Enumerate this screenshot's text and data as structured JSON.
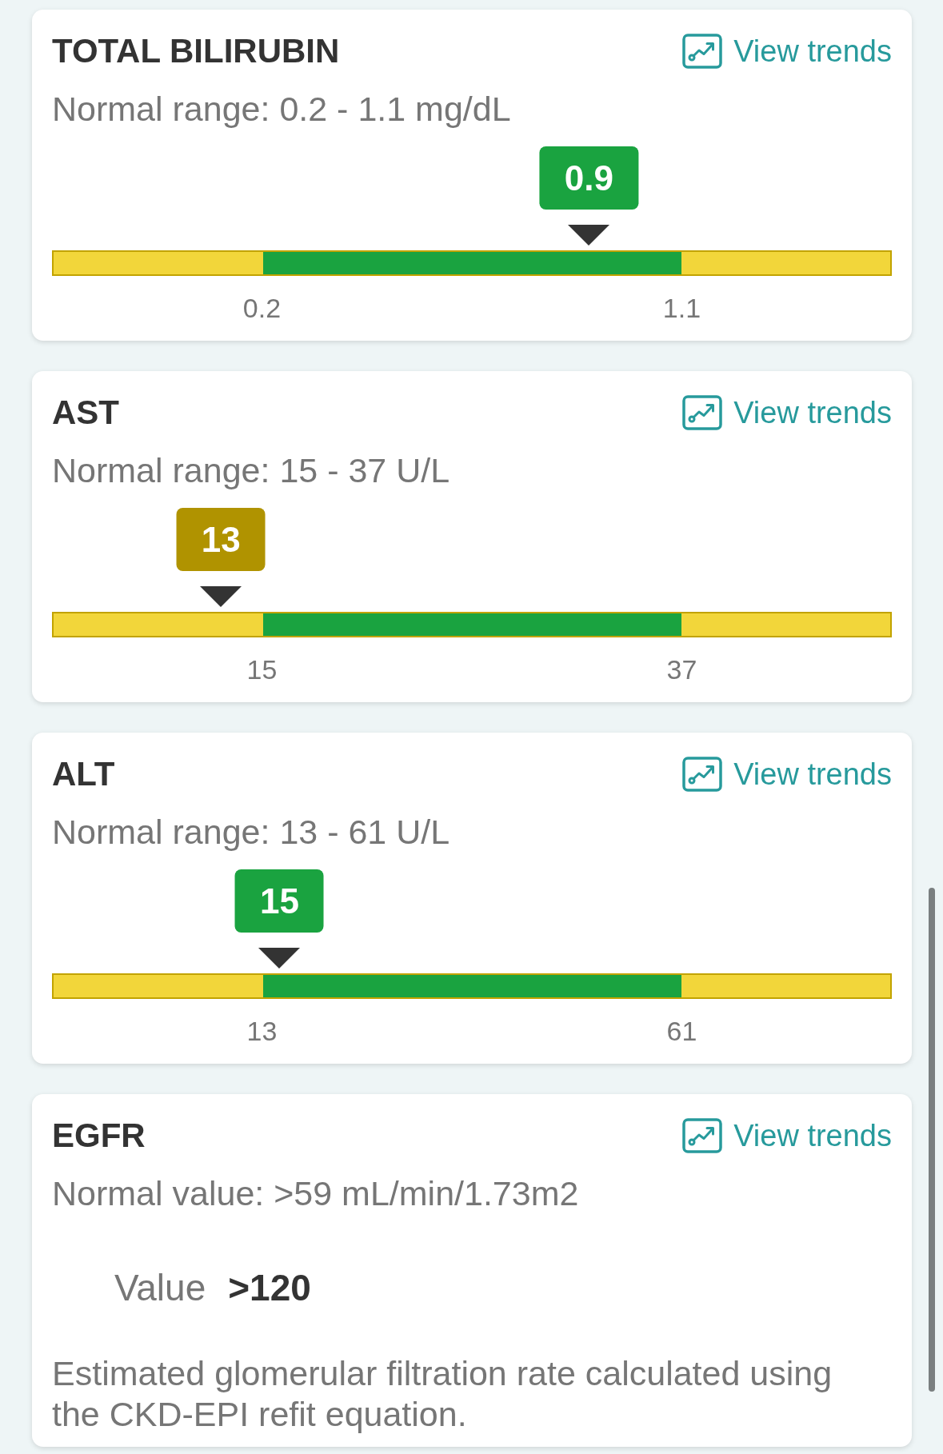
{
  "tests": [
    {
      "kind": "range",
      "title": "TOTAL BILIRUBIN",
      "trend_link": "View trends",
      "reference": "Normal range: 0.2 - 1.1 mg/dL",
      "marker": {
        "value": "0.9",
        "level": 0.64,
        "color": "#1aa340"
      },
      "limits": [
        "0.2",
        "1.1"
      ]
    },
    {
      "kind": "range",
      "title": "AST",
      "trend_link": "View trends",
      "reference": "Normal range: 15 - 37 U/L",
      "marker": {
        "value": "13",
        "level": 0.2,
        "color": "#b09300"
      },
      "limits": [
        "15",
        "37"
      ]
    },
    {
      "kind": "range",
      "title": "ALT",
      "trend_link": "View trends",
      "reference": "Normal range: 13 - 61 U/L",
      "marker": {
        "value": "15",
        "level": 0.27,
        "color": "#1aa340"
      },
      "limits": [
        "13",
        "61"
      ]
    },
    {
      "kind": "value",
      "title": "EGFR",
      "trend_link": "View trends",
      "reference": "Normal value: >59 mL/min/1.73m2",
      "value_label": "Value",
      "value": ">120",
      "description": "Estimated glomerular filtration rate calculated using the CKD-EPI refit equation."
    }
  ]
}
